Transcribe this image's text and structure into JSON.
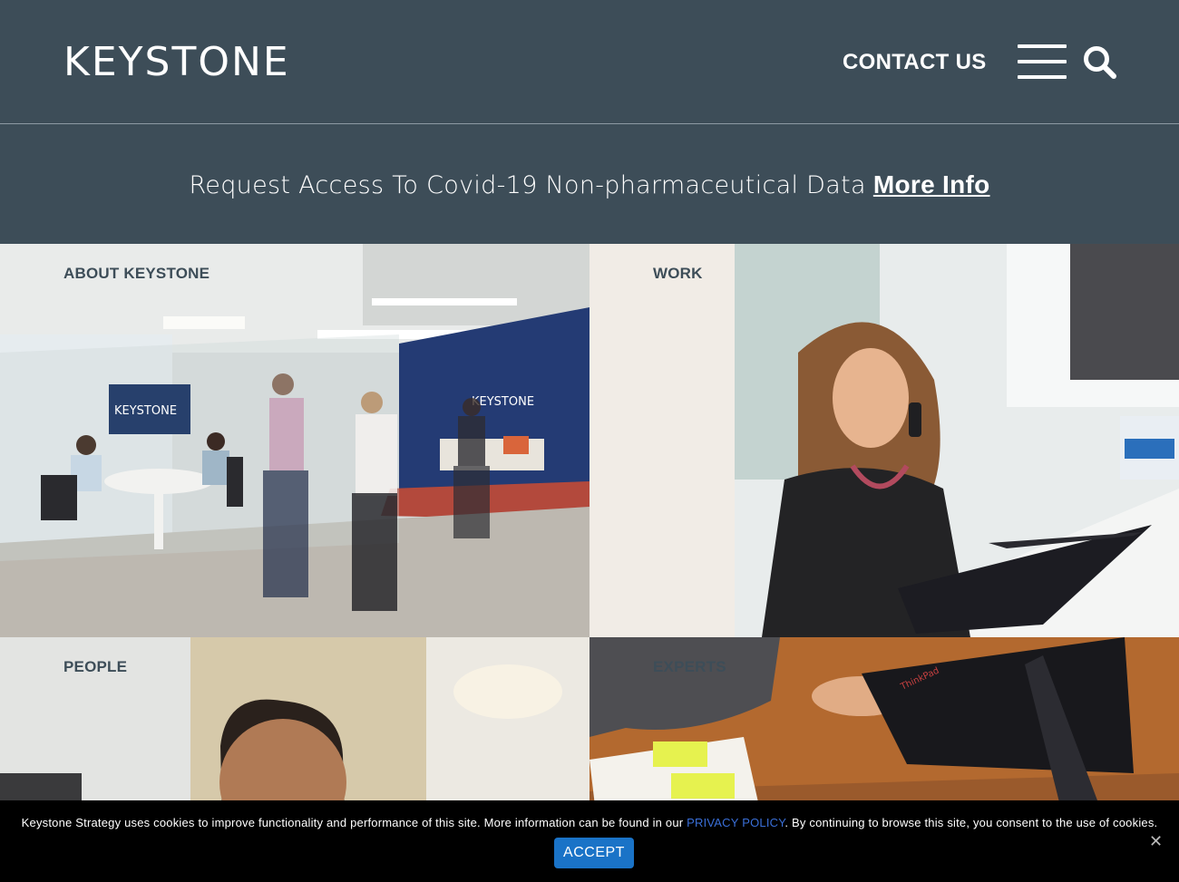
{
  "header": {
    "logo": "KEYSTONE",
    "contact_label": "CONTACT US",
    "menu_icon": "hamburger-icon",
    "search_icon": "search-icon"
  },
  "banner": {
    "text": "Request Access To Covid-19 Non-pharmaceutical Data",
    "link_label": "More Info"
  },
  "tiles": [
    {
      "label": "ABOUT KEYSTONE",
      "wall_sign": "KEYSTONE",
      "tv_sign": "KEYSTONE"
    },
    {
      "label": "WORK"
    },
    {
      "label": "PEOPLE"
    },
    {
      "label": "EXPERTS",
      "laptop_brand": "ThinkPad"
    }
  ],
  "cookie_bar": {
    "text_before": "Keystone Strategy uses cookies to improve functionality and performance of this site. More information can be found in our ",
    "link_label": "PRIVACY POLICY",
    "text_after": ". By continuing to browse this site, you consent to the use of cookies.",
    "accept_label": "ACCEPT",
    "close_label": "✕"
  },
  "colors": {
    "header_bg": "#3d4d58",
    "accent_blue": "#1a73c7",
    "cookie_bg": "#000000"
  }
}
